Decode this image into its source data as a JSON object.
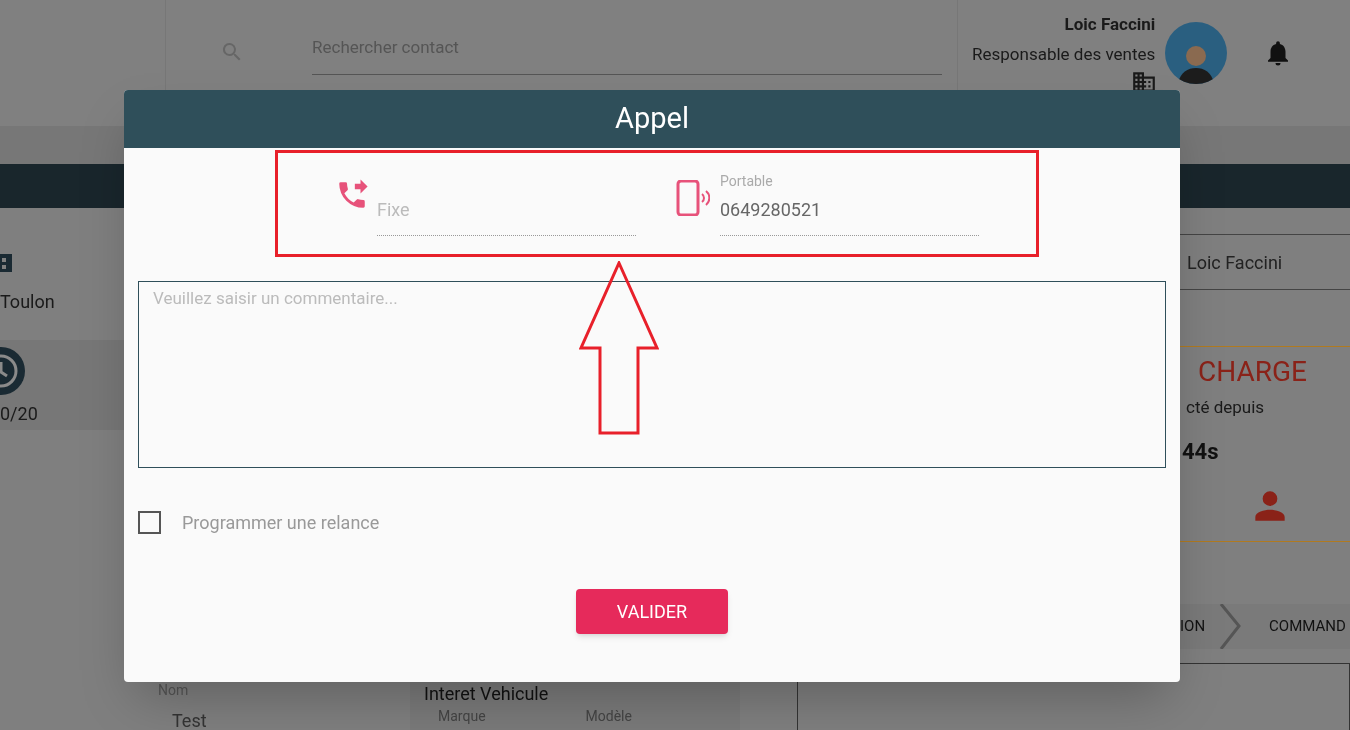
{
  "header": {
    "search": {
      "placeholder": "Rechercher contact"
    },
    "user": {
      "name": "Loic Faccini",
      "role": "Responsable des ventes"
    }
  },
  "background": {
    "location": "Toulon",
    "score": "0/20",
    "assignee": "Loic Faccini",
    "status_title": "CHARGE",
    "status_text": "cté depuis",
    "duration": "44s",
    "steps": [
      "ION",
      "COMMAND"
    ],
    "contact_label": "Nom",
    "contact_value": "Test",
    "vehicle_title": "Interet Vehicule",
    "vehicle_columns": [
      "Marque",
      "Modèle"
    ]
  },
  "dialog": {
    "title": "Appel",
    "phones": [
      {
        "kind": "landline",
        "placeholder": "Fixe"
      },
      {
        "kind": "mobile",
        "label": "Portable",
        "value": "0649280521"
      }
    ],
    "comment": {
      "placeholder": "Veuillez saisir un commentaire..."
    },
    "reminder": {
      "label": "Programmer une relance",
      "checked": false
    },
    "submit": "VALIDER"
  }
}
